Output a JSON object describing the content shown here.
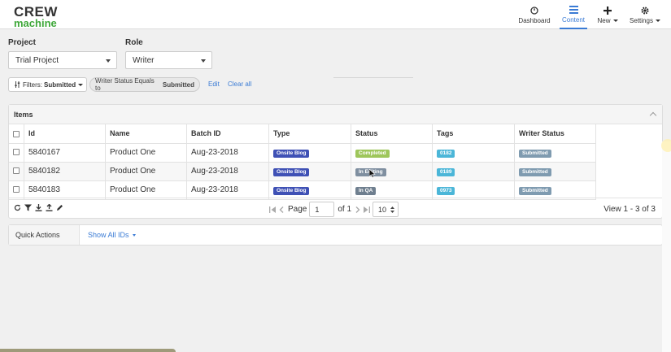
{
  "header": {
    "logo_line1": "CREW",
    "logo_line2": "machine",
    "nav": [
      {
        "label": "Dashboard",
        "icon": "gauge-icon"
      },
      {
        "label": "Content",
        "icon": "list-icon"
      },
      {
        "label": "New",
        "icon": "plus-icon"
      },
      {
        "label": "Settings",
        "icon": "gear-icon"
      }
    ]
  },
  "filters": {
    "project_label": "Project",
    "project_value": "Trial Project",
    "role_label": "Role",
    "role_value": "Writer",
    "filter_chip_prefix": "Filters: ",
    "filter_chip_value": "Submitted",
    "pill_prefix": "Writer Status Equals to ",
    "pill_value": "Submitted",
    "edit_label": "Edit",
    "clear_label": "Clear all"
  },
  "items": {
    "title": "Items",
    "columns": [
      "Id",
      "Name",
      "Batch ID",
      "Type",
      "Status",
      "Tags",
      "Writer Status"
    ],
    "rows": [
      {
        "id": "5840167",
        "name": "Product One",
        "batch": "Aug-23-2018",
        "type": "Onsite Blog",
        "status": "Completed",
        "status_color": "#9ec65b",
        "tag": "0182",
        "writer_status": "Submitted"
      },
      {
        "id": "5840182",
        "name": "Product One",
        "batch": "Aug-23-2018",
        "type": "Onsite Blog",
        "status": "In Editing",
        "status_color": "#7f8fa0",
        "tag": "0189",
        "writer_status": "Submitted"
      },
      {
        "id": "5840183",
        "name": "Product One",
        "batch": "Aug-23-2018",
        "type": "Onsite Blog",
        "status": "In QA",
        "status_color": "#6f7f8f",
        "tag": "0973",
        "writer_status": "Submitted"
      }
    ],
    "pager": {
      "page_label": "Page",
      "page_value": "1",
      "of_label": "of 1",
      "page_size": "10",
      "view_info": "View 1 - 3 of 3"
    }
  },
  "quick_actions": {
    "label": "Quick Actions",
    "link": "Show All IDs"
  },
  "colors": {
    "accent": "#3a7bd5",
    "brand_green": "#3fa83a",
    "type_badge": "#3f51b5",
    "tag_badge": "#4bb6d8",
    "writer_badge": "#7f9bb0"
  }
}
